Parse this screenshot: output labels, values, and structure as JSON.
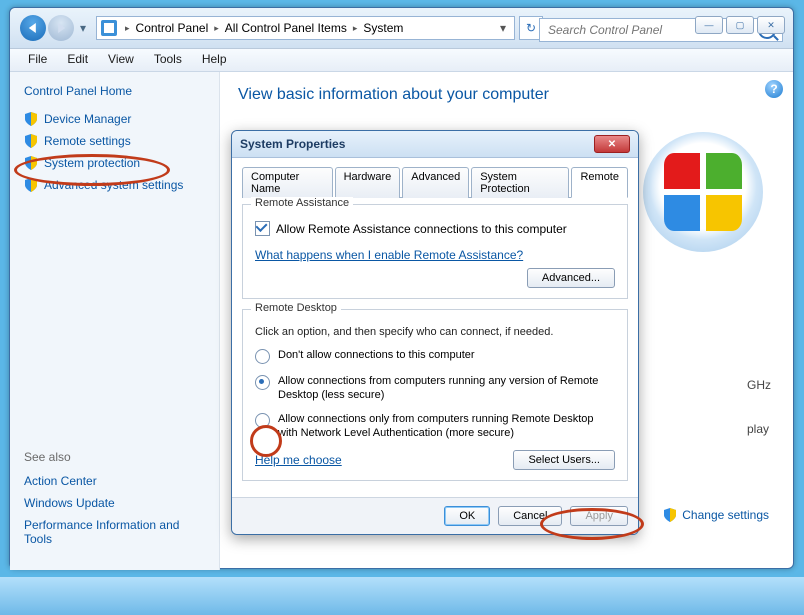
{
  "window": {
    "breadcrumb": [
      "Control Panel",
      "All Control Panel Items",
      "System"
    ],
    "search_placeholder": "Search Control Panel",
    "menus": [
      "File",
      "Edit",
      "View",
      "Tools",
      "Help"
    ],
    "page_title": "View basic information about your computer",
    "info_ghz": "GHz",
    "info_play": "play",
    "change_settings": "Change settings"
  },
  "sidebar": {
    "home": "Control Panel Home",
    "links": [
      {
        "icon": "shield",
        "label": "Device Manager"
      },
      {
        "icon": "shield",
        "label": "Remote settings"
      },
      {
        "icon": "shield",
        "label": "System protection"
      },
      {
        "icon": "shield",
        "label": "Advanced system settings"
      }
    ],
    "seealso_header": "See also",
    "seealso": [
      "Action Center",
      "Windows Update",
      "Performance Information and Tools"
    ]
  },
  "dialog": {
    "title": "System Properties",
    "tabs": [
      "Computer Name",
      "Hardware",
      "Advanced",
      "System Protection",
      "Remote"
    ],
    "active_tab": "Remote",
    "ra": {
      "legend": "Remote Assistance",
      "checkbox": "Allow Remote Assistance connections to this computer",
      "checked": true,
      "link": "What happens when I enable Remote Assistance?",
      "advanced": "Advanced..."
    },
    "rd": {
      "legend": "Remote Desktop",
      "desc": "Click an option, and then specify who can connect, if needed.",
      "options": [
        "Don't allow connections to this computer",
        "Allow connections from computers running any version of Remote Desktop (less secure)",
        "Allow connections only from computers running Remote Desktop with Network Level Authentication (more secure)"
      ],
      "selected": 1,
      "help": "Help me choose",
      "select_users": "Select Users..."
    },
    "buttons": {
      "ok": "OK",
      "cancel": "Cancel",
      "apply": "Apply"
    }
  }
}
